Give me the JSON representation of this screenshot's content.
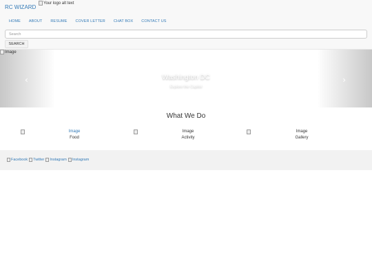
{
  "header": {
    "brand": "RC WIZARD",
    "logo_alt": "Your logo alt text"
  },
  "nav": {
    "items": [
      "HOME",
      "ABOUT",
      "RESUME",
      "COVER LETTER",
      "CHAT BOX",
      "CONTACT US"
    ]
  },
  "search": {
    "placeholder": "Search",
    "button_label": "SEARCH"
  },
  "carousel": {
    "image_alt": "Image",
    "title": "Washington DC",
    "subtitle": "Explore the Capitol",
    "prev_icon": "chevron-left-icon",
    "next_icon": "chevron-right-icon"
  },
  "services": {
    "title": "What We Do",
    "items": [
      {
        "image_alt": "Image",
        "label": "Food"
      },
      {
        "image_alt": "Image",
        "label": "Activity"
      },
      {
        "image_alt": "Image",
        "label": "Gallery"
      }
    ]
  },
  "footer": {
    "social": [
      "Facebook",
      "Twitter",
      "Instagram",
      "Instagram"
    ]
  },
  "colors": {
    "link": "#337ab7",
    "navbar_bg": "#f8f8f8",
    "footer_bg": "#f2f2f2"
  }
}
